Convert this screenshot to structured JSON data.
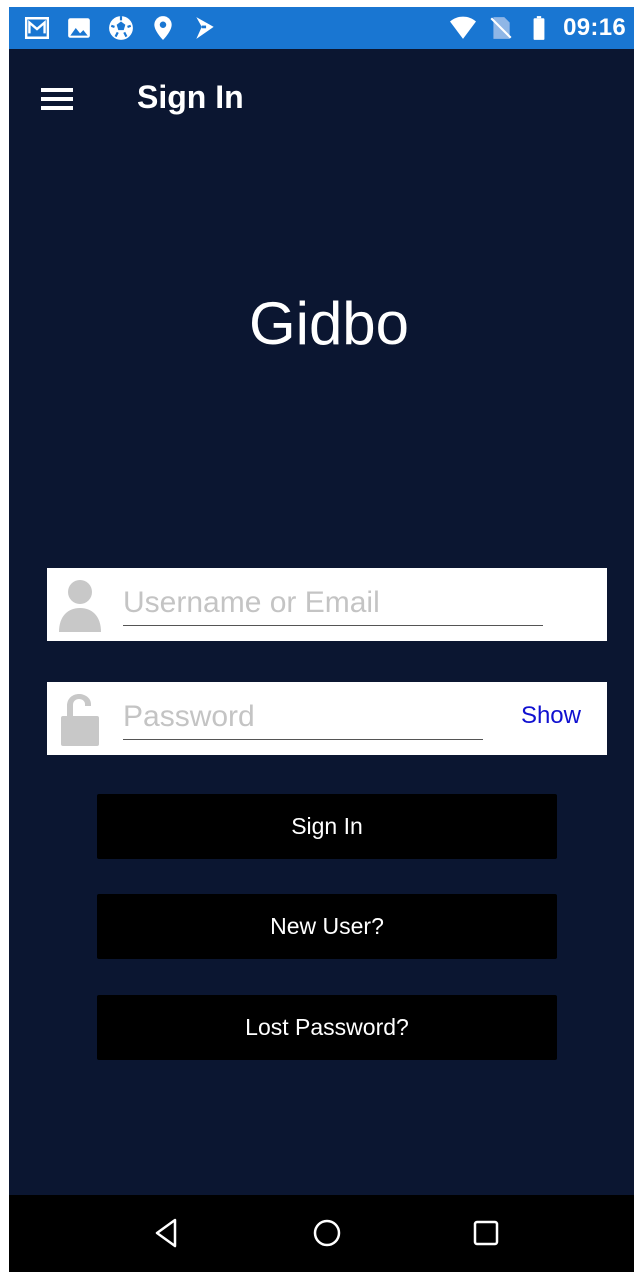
{
  "status_bar": {
    "time": "09:16",
    "left_icons": [
      "gmail-icon",
      "image-icon",
      "soccer-ball-icon",
      "location-icon",
      "app-notification-icon"
    ],
    "right_icons": [
      "wifi-icon",
      "no-sim-icon",
      "battery-icon"
    ]
  },
  "app_bar": {
    "title": "Sign In",
    "menu_icon": "hamburger-menu-icon"
  },
  "brand": {
    "name": "Gidbo"
  },
  "form": {
    "username": {
      "placeholder": "Username or Email",
      "value": "",
      "icon": "user-icon"
    },
    "password": {
      "placeholder": "Password",
      "value": "",
      "icon": "unlock-icon",
      "show_label": "Show"
    }
  },
  "buttons": {
    "sign_in": "Sign In",
    "new_user": "New User?",
    "lost_password": "Lost Password?"
  },
  "nav_bar": {
    "icons": [
      "back-icon",
      "home-icon",
      "recents-icon"
    ]
  },
  "colors": {
    "status_bar": "#1976d2",
    "background": "#0b1631",
    "button": "#000000",
    "link": "#1010d0",
    "field_icon": "#c8c8c8"
  }
}
